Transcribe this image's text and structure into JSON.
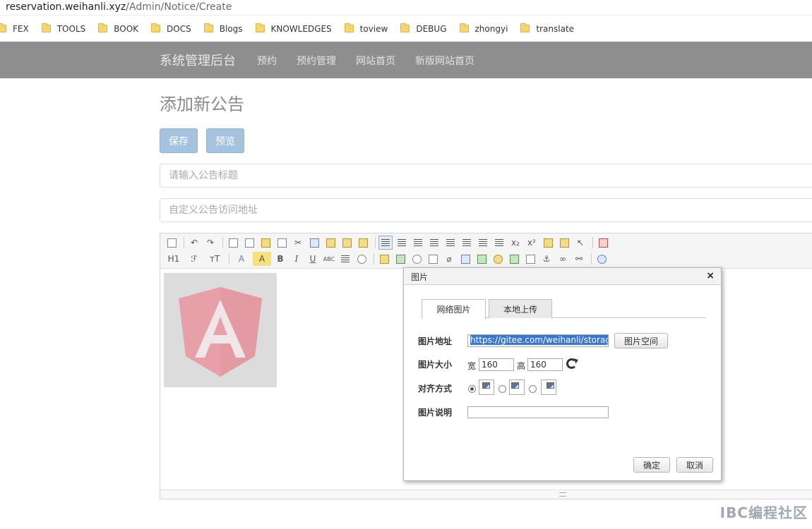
{
  "browser": {
    "address_host": "reservation.weihanli.xyz",
    "address_path": "/Admin/Notice/Create",
    "bookmarks": [
      "FEX",
      "TOOLS",
      "BOOK",
      "DOCS",
      "Blogs",
      "KNOWLEDGES",
      "toview",
      "DEBUG",
      "zhongyi",
      "translate"
    ]
  },
  "navbar": {
    "brand": "系统管理后台",
    "links": [
      "预约",
      "预约管理",
      "网站首页",
      "新版网站首页"
    ]
  },
  "page": {
    "title": "添加新公告",
    "save_label": "保存",
    "preview_label": "预览",
    "title_placeholder": "请输入公告标题",
    "url_placeholder": "自定义公告访问地址"
  },
  "editor": {
    "toolbar_labels": {
      "heading": "H1",
      "font_family": "ℱ",
      "font_size": "тT",
      "font_color": "A",
      "back_color": "A",
      "bold": "B",
      "italic": "I",
      "underline": "U",
      "strike": "ABC",
      "subscript": "x₂",
      "superscript": "x²"
    }
  },
  "dialog": {
    "title": "图片",
    "close_label": "×",
    "tabs": [
      "网络图片",
      "本地上传"
    ],
    "url_label": "图片地址",
    "url_value": "https://gitee.com/weihanli/storage/",
    "space_button": "图片空间",
    "size_label": "图片大小",
    "width_label": "宽",
    "width_value": "160",
    "height_label": "高",
    "height_value": "160",
    "align_label": "对齐方式",
    "desc_label": "图片说明",
    "ok_label": "确定",
    "cancel_label": "取消"
  },
  "watermark": "IBC编程社区",
  "colors": {
    "navbar": "#8e8e8e",
    "button": "#a5c2df",
    "angular_shield": "#e8a0a8",
    "selection": "#3875d7"
  }
}
